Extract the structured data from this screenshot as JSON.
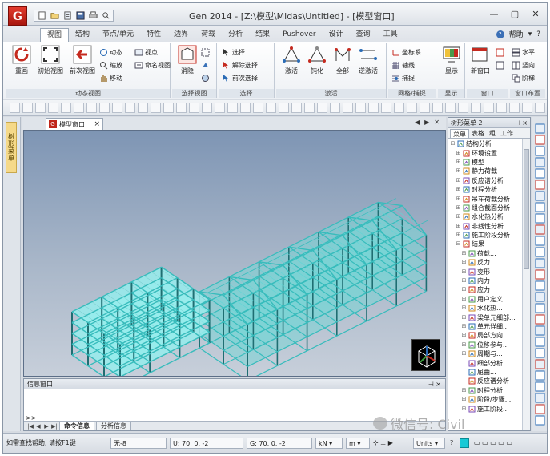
{
  "app": {
    "title": "Gen 2014 - [Z:\\模型\\Midas\\Untitled] - [模型窗口]",
    "logo_letter": "G"
  },
  "qat": {
    "icons": [
      "new-file-icon",
      "open-folder-icon",
      "open-icon",
      "save-icon",
      "print-icon",
      "print-preview-icon"
    ]
  },
  "window_controls": {
    "minimize": "—",
    "restore": "▢",
    "close": "✕"
  },
  "menu": {
    "tabs": [
      "视图",
      "结构",
      "节点/单元",
      "特性",
      "边界",
      "荷载",
      "分析",
      "结果",
      "Pushover",
      "设计",
      "查询",
      "工具"
    ],
    "active_tab": "视图",
    "help_label": "帮助"
  },
  "ribbon": {
    "groups": [
      {
        "id": "dynamic-view",
        "label": "动态视图",
        "big_buttons": [
          "重画",
          "初始视图",
          "前次视图"
        ],
        "small_buttons": [
          "动态",
          "缩放",
          "移动",
          "视点",
          "命名视图"
        ]
      },
      {
        "id": "select-view",
        "label": "选择视图",
        "big_buttons": [
          "消隐"
        ],
        "small_buttons": []
      },
      {
        "id": "select",
        "label": "选择",
        "big_buttons": [],
        "small_buttons": [
          "选择",
          "解除选择",
          "前次选择"
        ]
      },
      {
        "id": "activate",
        "label": "激活",
        "big_buttons": [
          "激活",
          "钝化",
          "全部",
          "逆激活"
        ],
        "small_buttons": []
      },
      {
        "id": "grid-snap",
        "label": "网格/捕捉",
        "big_buttons": [],
        "small_buttons": [
          "坐标系",
          "轴线",
          "捕捉"
        ]
      },
      {
        "id": "display",
        "label": "显示",
        "big_buttons": [
          "显示"
        ],
        "small_buttons": []
      },
      {
        "id": "window",
        "label": "窗口",
        "big_buttons": [
          "新窗口"
        ],
        "small_buttons": []
      },
      {
        "id": "window-layout",
        "label": "窗口布置",
        "big_buttons": [],
        "small_buttons": [
          "水平",
          "竖向",
          "阶梯"
        ]
      }
    ]
  },
  "side_tab": "树形菜单",
  "document": {
    "tab_label": "模型窗口",
    "tab_close": "×"
  },
  "info_window": {
    "title": "信息窗口",
    "prompt": ">>",
    "tabs": [
      "命令信息",
      "分析信息"
    ],
    "active_tab": "命令信息"
  },
  "tree_panel": {
    "title": "树形菜单 2",
    "tabs": [
      "菜单",
      "表格",
      "组",
      "工作"
    ],
    "active_tab": "菜单",
    "items": [
      {
        "level": 0,
        "toggle": "⊟",
        "label": "结构分析",
        "icon": "analysis-icon"
      },
      {
        "level": 1,
        "toggle": "⊞",
        "label": "环境设置",
        "icon": "settings-icon"
      },
      {
        "level": 1,
        "toggle": "⊞",
        "label": "模型",
        "icon": "model-icon"
      },
      {
        "level": 1,
        "toggle": "⊞",
        "label": "静力荷载",
        "icon": "static-load-icon"
      },
      {
        "level": 1,
        "toggle": "⊞",
        "label": "反应谱分析",
        "icon": "spectrum-icon"
      },
      {
        "level": 1,
        "toggle": "⊞",
        "label": "时程分析",
        "icon": "time-history-icon"
      },
      {
        "level": 1,
        "toggle": "⊞",
        "label": "吊车荷载分析",
        "icon": "crane-icon"
      },
      {
        "level": 1,
        "toggle": "⊞",
        "label": "组合截面分析",
        "icon": "section-icon"
      },
      {
        "level": 1,
        "toggle": "⊞",
        "label": "水化热分析",
        "icon": "heat-icon"
      },
      {
        "level": 1,
        "toggle": "⊞",
        "label": "非线性分析",
        "icon": "nonlinear-icon"
      },
      {
        "level": 1,
        "toggle": "⊞",
        "label": "施工阶段分析",
        "icon": "construction-icon"
      },
      {
        "level": 1,
        "toggle": "⊟",
        "label": "结果",
        "icon": "results-icon"
      },
      {
        "level": 2,
        "toggle": "⊞",
        "label": "荷载...",
        "icon": "load-combo-icon"
      },
      {
        "level": 2,
        "toggle": "⊞",
        "label": "反力",
        "icon": "reaction-icon"
      },
      {
        "level": 2,
        "toggle": "⊞",
        "label": "变形",
        "icon": "deform-icon"
      },
      {
        "level": 2,
        "toggle": "⊞",
        "label": "内力",
        "icon": "force-icon"
      },
      {
        "level": 2,
        "toggle": "⊞",
        "label": "应力",
        "icon": "stress-icon"
      },
      {
        "level": 2,
        "toggle": "⊞",
        "label": "用户定义...",
        "icon": "user-defined-icon"
      },
      {
        "level": 2,
        "toggle": "⊞",
        "label": "水化热...",
        "icon": "heat-result-icon"
      },
      {
        "level": 2,
        "toggle": "⊞",
        "label": "梁单元细部...",
        "icon": "beam-detail-icon"
      },
      {
        "level": 2,
        "toggle": "⊞",
        "label": "单元详细...",
        "icon": "element-detail-icon"
      },
      {
        "level": 2,
        "toggle": "⊞",
        "label": "局部方向...",
        "icon": "local-dir-icon"
      },
      {
        "level": 2,
        "toggle": "⊞",
        "label": "位移参与...",
        "icon": "participation-icon"
      },
      {
        "level": 2,
        "toggle": "⊞",
        "label": "周期与...",
        "icon": "period-icon"
      },
      {
        "level": 2,
        "toggle": "",
        "label": "细部分析...",
        "icon": "fine-analysis-icon"
      },
      {
        "level": 2,
        "toggle": "",
        "label": "屈曲...",
        "icon": "buckling-icon"
      },
      {
        "level": 2,
        "toggle": "",
        "label": "反应谱分析",
        "icon": "spectrum-result-icon"
      },
      {
        "level": 2,
        "toggle": "⊞",
        "label": "时程分析",
        "icon": "th-result-icon"
      },
      {
        "level": 2,
        "toggle": "⊞",
        "label": "阶段/步骤...",
        "icon": "stage-icon"
      },
      {
        "level": 2,
        "toggle": "⊞",
        "label": "施工阶段...",
        "icon": "stage-result-icon"
      }
    ]
  },
  "status_bar": {
    "hint": "如需查找帮助, 请按F1键",
    "selection": "无-8",
    "u_coord": "U: 70, 0, -2",
    "g_coord": "G: 70, 0, -2",
    "unit_force": "kN",
    "unit_length": "m",
    "filter": "Units"
  },
  "watermark": "微信号: Civil"
}
